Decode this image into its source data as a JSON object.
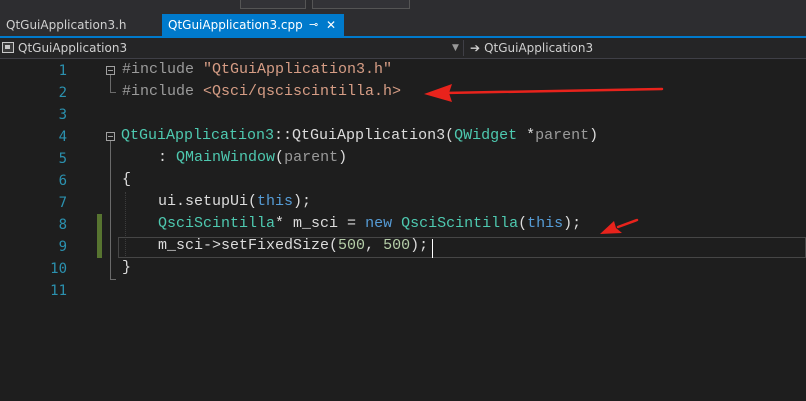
{
  "tabs": [
    {
      "label": "QtGuiApplication3.h",
      "active": false
    },
    {
      "label": "QtGuiApplication3.cpp",
      "active": true
    }
  ],
  "tab_icons": {
    "pin": "pin-icon",
    "close": "close-icon"
  },
  "navbar": {
    "scope": "QtGuiApplication3",
    "member": "QtGuiApplication3"
  },
  "editor": {
    "line_numbers": [
      "1",
      "2",
      "3",
      "4",
      "5",
      "6",
      "7",
      "8",
      "9",
      "10",
      "11"
    ],
    "tokens": {
      "l1_pp": "#include ",
      "l1_str": "\"QtGuiApplication3.h\"",
      "l2_pp": "#include ",
      "l2_str": "<Qsci/qsciscintilla.h>",
      "l4_cls": "QtGuiApplication3",
      "l4_sep": "::",
      "l4_fn": "QtGuiApplication3",
      "l4_open": "(",
      "l4_type": "QWidget",
      "l4_star": " *",
      "l4_param": "parent",
      "l4_close": ")",
      "l5_colon": "    : ",
      "l5_type": "QMainWindow",
      "l5_open": "(",
      "l5_param": "parent",
      "l5_close": ")",
      "l6_brace": "{",
      "l7_pre": "    ui.setupUi(",
      "l7_kw": "this",
      "l7_post": ");",
      "l8_pre": "    ",
      "l8_type": "QsciScintilla",
      "l8_mid": "* m_sci = ",
      "l8_new": "new",
      "l8_sp": " ",
      "l8_type2": "QsciScintilla",
      "l8_open": "(",
      "l8_kw": "this",
      "l8_close": ");",
      "l9_pre": "    m_sci->setFixedSize(",
      "l9_n1": "500",
      "l9_comma": ", ",
      "l9_n2": "500",
      "l9_post": ");",
      "l10_brace": "}"
    }
  },
  "colors": {
    "accent": "#007acc",
    "annotation_arrow": "#e8231c",
    "change_bar": "#577430"
  }
}
